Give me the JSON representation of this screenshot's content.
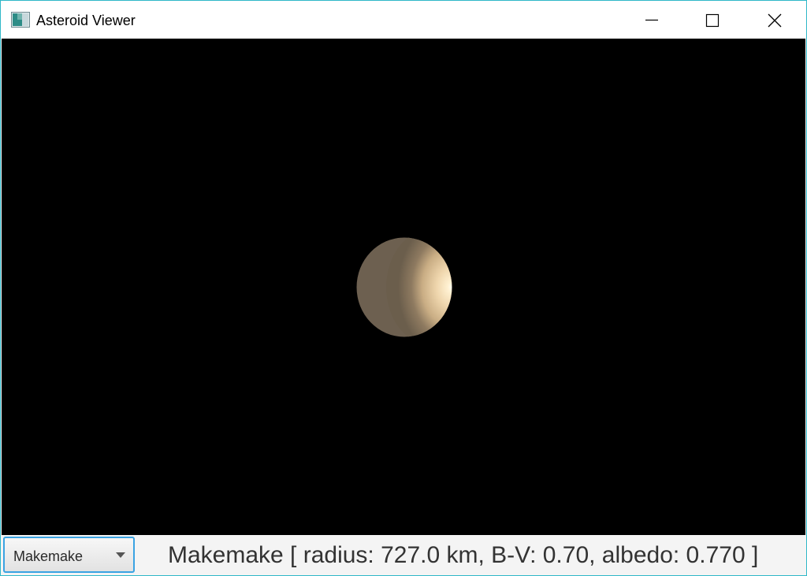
{
  "window": {
    "title": "Asteroid Viewer",
    "border_color": "#2fb8c8"
  },
  "titlebar": {
    "buttons": [
      {
        "name": "minimize",
        "icon": "minimize-icon"
      },
      {
        "name": "maximize",
        "icon": "maximize-icon"
      },
      {
        "name": "close",
        "icon": "close-icon"
      }
    ]
  },
  "viewport": {
    "background_color": "#000000",
    "object": {
      "name": "Makemake",
      "surface_color": "#e8cfa6"
    }
  },
  "controls": {
    "asteroid_select": {
      "selected": "Makemake",
      "icon": "chevron-down-icon",
      "focus_color": "#3aa3e3"
    }
  },
  "info": {
    "text": "Makemake [ radius: 727.0 km, B-V: 0.70, albedo: 0.770 ]"
  }
}
